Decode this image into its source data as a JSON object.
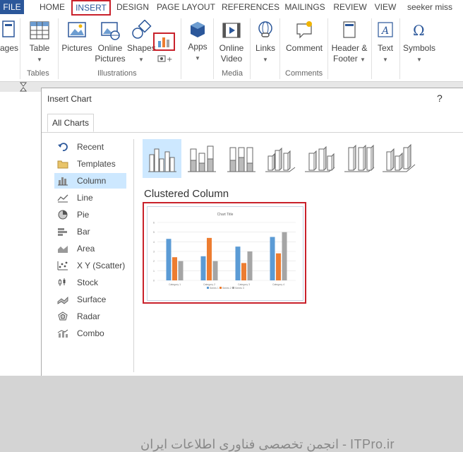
{
  "tabs": {
    "file": "FILE",
    "home": "HOME",
    "insert": "INSERT",
    "design": "DESIGN",
    "page_layout": "PAGE LAYOUT",
    "references": "REFERENCES",
    "mailings": "MAILINGS",
    "review": "REVIEW",
    "view": "VIEW",
    "user": "seeker miss"
  },
  "ribbon": {
    "pages": "ages",
    "table": "Table",
    "pictures": "Pictures",
    "online_pictures_1": "Online",
    "online_pictures_2": "Pictures",
    "shapes": "Shapes",
    "apps": "Apps",
    "online_video_1": "Online",
    "online_video_2": "Video",
    "links": "Links",
    "comment": "Comment",
    "header_footer_1": "Header &",
    "header_footer_2": "Footer",
    "text": "Text",
    "symbols": "Symbols",
    "groups": {
      "tables": "Tables",
      "illustrations": "Illustrations",
      "media": "Media",
      "comments": "Comments"
    }
  },
  "dialog": {
    "title": "Insert Chart",
    "help": "?",
    "tab": "All Charts",
    "selected_type": "Clustered Column",
    "categories": [
      {
        "label": "Recent",
        "icon": "undo-icon"
      },
      {
        "label": "Templates",
        "icon": "folder-icon"
      },
      {
        "label": "Column",
        "icon": "column-chart-icon"
      },
      {
        "label": "Line",
        "icon": "line-chart-icon"
      },
      {
        "label": "Pie",
        "icon": "pie-chart-icon"
      },
      {
        "label": "Bar",
        "icon": "bar-chart-icon"
      },
      {
        "label": "Area",
        "icon": "area-chart-icon"
      },
      {
        "label": "X Y (Scatter)",
        "icon": "scatter-chart-icon"
      },
      {
        "label": "Stock",
        "icon": "stock-chart-icon"
      },
      {
        "label": "Surface",
        "icon": "surface-chart-icon"
      },
      {
        "label": "Radar",
        "icon": "radar-chart-icon"
      },
      {
        "label": "Combo",
        "icon": "combo-chart-icon"
      }
    ],
    "selected_index": 2
  },
  "chart_data": {
    "type": "bar",
    "title": "Chart Title",
    "categories": [
      "Category 1",
      "Category 2",
      "Category 3",
      "Category 4"
    ],
    "series": [
      {
        "name": "Series 1",
        "values": [
          4.3,
          2.5,
          3.5,
          4.5
        ]
      },
      {
        "name": "Series 2",
        "values": [
          2.4,
          4.4,
          1.8,
          2.8
        ]
      },
      {
        "name": "Series 3",
        "values": [
          2,
          2,
          3,
          5
        ]
      }
    ],
    "ylim": [
      0,
      6
    ],
    "yticks": [
      0,
      1,
      2,
      3,
      4,
      5,
      6
    ],
    "colors": [
      "#5b9bd5",
      "#ed7d31",
      "#a5a5a5"
    ],
    "legend": "bottom",
    "grid": true
  },
  "watermark": "انجمن تخصصی فناوری اطلاعات ایران - ITPro.ir",
  "colors": {
    "accent": "#2b579a",
    "highlight": "#c9212b",
    "selection": "#cde8ff"
  }
}
